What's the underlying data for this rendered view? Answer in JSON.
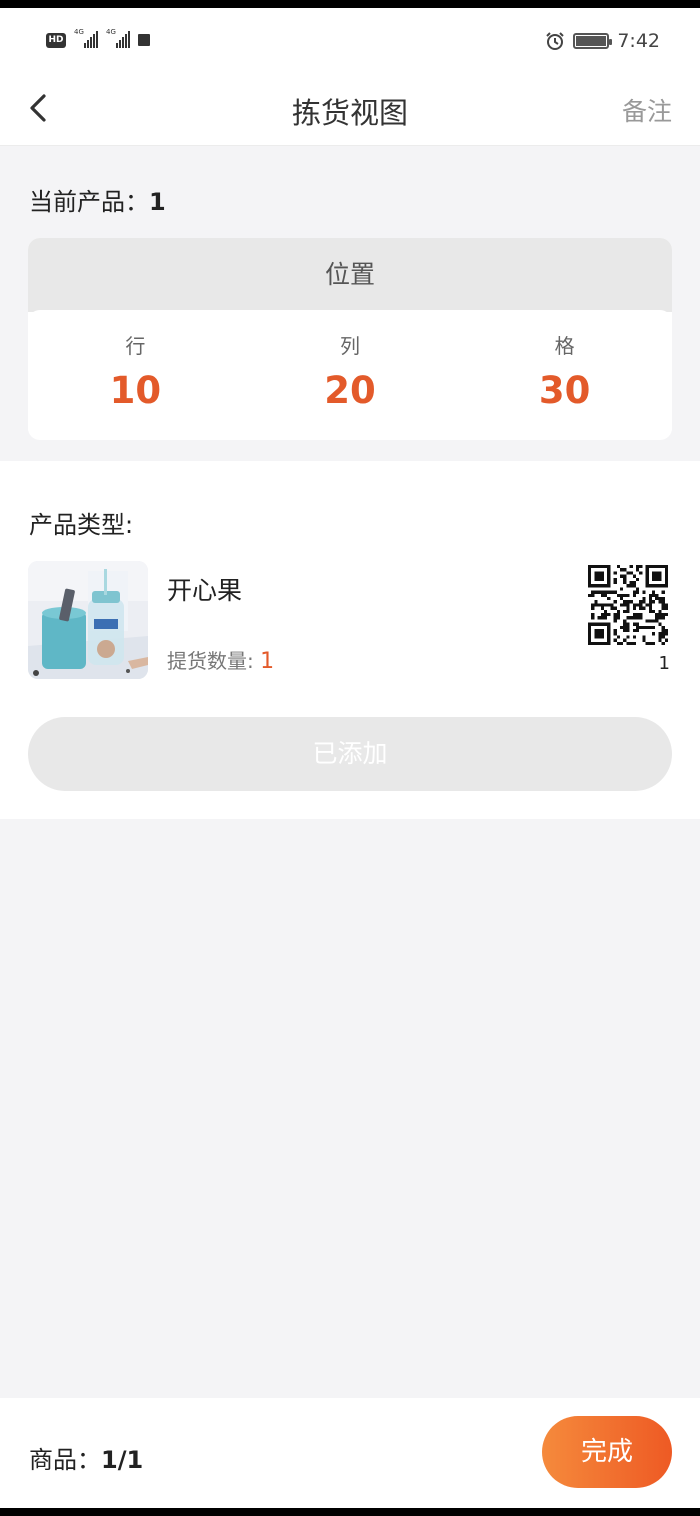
{
  "status": {
    "time": "7:42",
    "hd": "HD",
    "sig1": "4G",
    "sig2": "4G"
  },
  "nav": {
    "title": "拣货视图",
    "right": "备注"
  },
  "current": {
    "label": "当前产品：",
    "value": "1"
  },
  "location": {
    "title": "位置",
    "row_label": "行",
    "row_value": "10",
    "col_label": "列",
    "col_value": "20",
    "cell_label": "格",
    "cell_value": "30"
  },
  "product": {
    "section_label": "产品类型:",
    "name": "开心果",
    "qty_label": "提货数量:",
    "qty_value": "1",
    "qr_count": "1",
    "added_label": "已添加"
  },
  "footer": {
    "goods_label": "商品：",
    "goods_value": "1/1",
    "done_label": "完成"
  },
  "colors": {
    "accent": "#e35a2a",
    "button_gradient_start": "#f58a3c",
    "button_gradient_end": "#ee5a24"
  }
}
